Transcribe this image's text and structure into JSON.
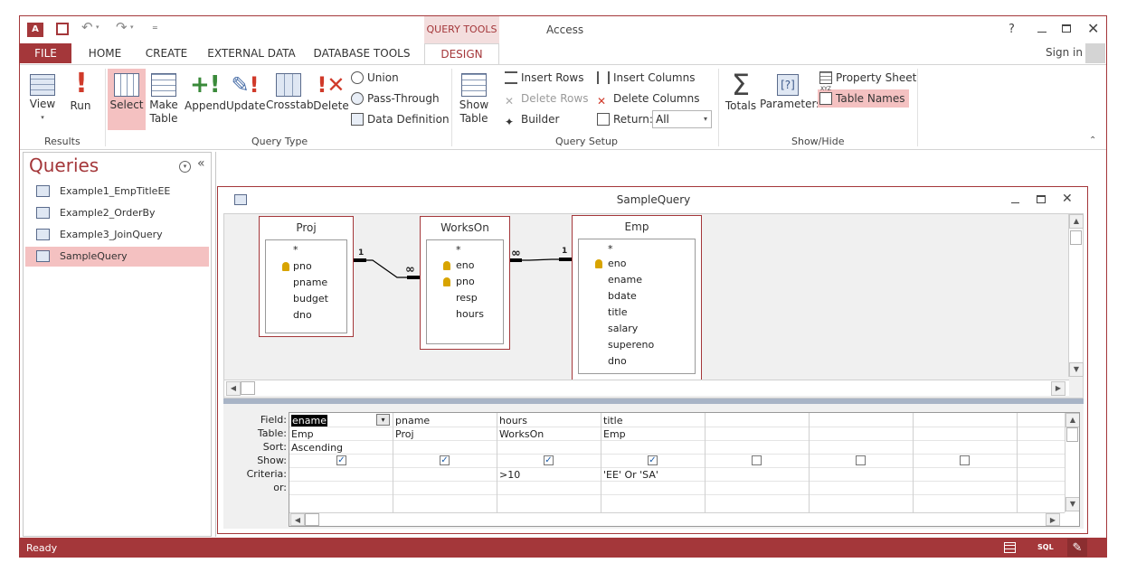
{
  "title_bar": {
    "context_tab": "QUERY TOOLS",
    "app_title": "Access",
    "help": "?",
    "sign_in": "Sign in"
  },
  "tabs": [
    "FILE",
    "HOME",
    "CREATE",
    "EXTERNAL DATA",
    "DATABASE TOOLS",
    "DESIGN"
  ],
  "ribbon": {
    "results": {
      "label": "Results",
      "view": "View",
      "run": "Run"
    },
    "query_type": {
      "label": "Query Type",
      "select": "Select",
      "make": "Make",
      "table": "Table",
      "append": "Append",
      "update": "Update",
      "crosstab": "Crosstab",
      "delete": "Delete",
      "union": "Union",
      "pass_through": "Pass-Through",
      "data_definition": "Data Definition"
    },
    "query_setup": {
      "label": "Query Setup",
      "show": "Show",
      "table": "Table",
      "insert_rows": "Insert Rows",
      "delete_rows": "Delete Rows",
      "builder": "Builder",
      "insert_columns": "Insert Columns",
      "delete_columns": "Delete Columns",
      "return_label": "Return:",
      "return_value": "All"
    },
    "show_hide": {
      "label": "Show/Hide",
      "totals": "Totals",
      "parameters": "Parameters",
      "property_sheet": "Property Sheet",
      "table_names": "Table Names",
      "xyz": "XYZ"
    }
  },
  "nav": {
    "title": "Queries",
    "items": [
      "Example1_EmpTitleEE",
      "Example2_OrderBy",
      "Example3_JoinQuery",
      "SampleQuery"
    ]
  },
  "query_window": {
    "title": "SampleQuery"
  },
  "tables": [
    {
      "name": "Proj",
      "fields": [
        "*",
        "pno",
        "pname",
        "budget",
        "dno"
      ]
    },
    {
      "name": "WorksOn",
      "fields": [
        "*",
        "eno",
        "pno",
        "resp",
        "hours"
      ]
    },
    {
      "name": "Emp",
      "fields": [
        "*",
        "eno",
        "ename",
        "bdate",
        "title",
        "salary",
        "supereno",
        "dno"
      ]
    }
  ],
  "joins": {
    "one": "1",
    "many": "∞"
  },
  "grid": {
    "row_labels": [
      "Field:",
      "Table:",
      "Sort:",
      "Show:",
      "Criteria:",
      "or:"
    ],
    "columns": [
      {
        "field": "ename",
        "table": "Emp",
        "sort": "Ascending",
        "show": true,
        "criteria": ""
      },
      {
        "field": "pname",
        "table": "Proj",
        "sort": "",
        "show": true,
        "criteria": ""
      },
      {
        "field": "hours",
        "table": "WorksOn",
        "sort": "",
        "show": true,
        "criteria": ">10"
      },
      {
        "field": "title",
        "table": "Emp",
        "sort": "",
        "show": true,
        "criteria": "'EE' Or 'SA'"
      },
      {
        "field": "",
        "table": "",
        "sort": "",
        "show": false,
        "criteria": ""
      },
      {
        "field": "",
        "table": "",
        "sort": "",
        "show": false,
        "criteria": ""
      },
      {
        "field": "",
        "table": "",
        "sort": "",
        "show": false,
        "criteria": ""
      }
    ]
  },
  "status": {
    "text": "Ready",
    "sql": "SQL"
  }
}
